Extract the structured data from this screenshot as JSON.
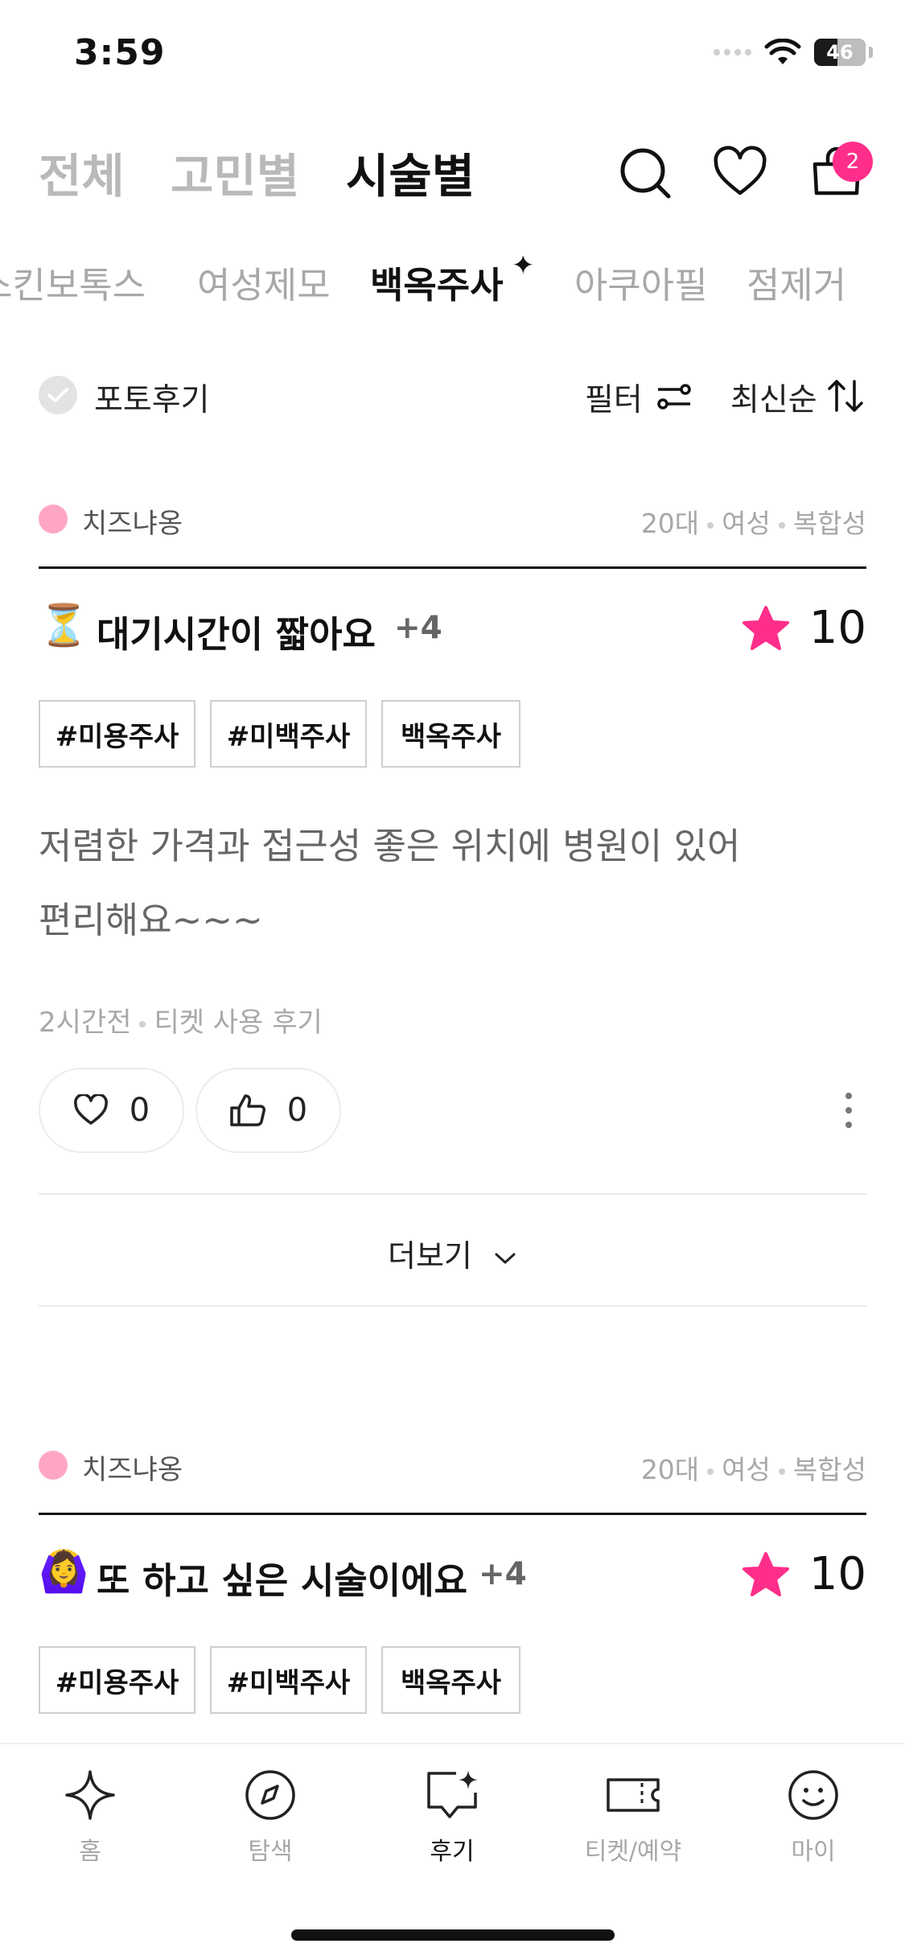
{
  "status": {
    "time": "3:59",
    "battery": "46"
  },
  "header": {
    "tabs": [
      {
        "label": "전체",
        "active": false
      },
      {
        "label": "고민별",
        "active": false
      },
      {
        "label": "시술별",
        "active": true
      }
    ],
    "icons": [
      "search-icon",
      "heart-icon",
      "cart-icon"
    ],
    "cart_count": "2"
  },
  "sub_tabs": [
    {
      "label": "스킨보톡스",
      "active": false
    },
    {
      "label": "여성제모",
      "active": false
    },
    {
      "label": "백옥주사",
      "active": true
    },
    {
      "label": "아쿠아필",
      "active": false
    },
    {
      "label": "점제거",
      "active": false
    }
  ],
  "filter_row": {
    "photo_review": "포토후기",
    "filter": "필터",
    "sort": "최신순"
  },
  "reviews": [
    {
      "author": "치즈냐옹",
      "age": "20대",
      "gender": "여성",
      "skin": "복합성",
      "emoji": "⏳",
      "title": "대기시간이 짧아요",
      "plus": "+4",
      "score": "10",
      "tags": [
        "#미용주사",
        "#미백주사",
        "백옥주사"
      ],
      "body": "저렴한 가격과 접근성 좋은 위치에 병원이 있어 편리해요~~~",
      "time": "2시간전",
      "type": "티켓 사용 후기",
      "likes": "0",
      "thumbs": "0",
      "more": "더보기"
    },
    {
      "author": "치즈냐옹",
      "age": "20대",
      "gender": "여성",
      "skin": "복합성",
      "emoji": "🙆‍♀️",
      "title": "또 하고 싶은 시술이에요",
      "plus": "+4",
      "score": "10",
      "tags": [
        "#미용주사",
        "#미백주사",
        "백옥주사"
      ]
    }
  ],
  "bottom_nav": [
    {
      "label": "홈",
      "icon": "sparkle-icon",
      "active": false
    },
    {
      "label": "탐색",
      "icon": "compass-icon",
      "active": false
    },
    {
      "label": "후기",
      "icon": "review-chat-icon",
      "active": true
    },
    {
      "label": "티켓/예약",
      "icon": "ticket-icon",
      "active": false
    },
    {
      "label": "마이",
      "icon": "smile-icon",
      "active": false
    }
  ],
  "colors": {
    "accent": "#ff2e8a",
    "author_dot": "#ffa6c6"
  }
}
